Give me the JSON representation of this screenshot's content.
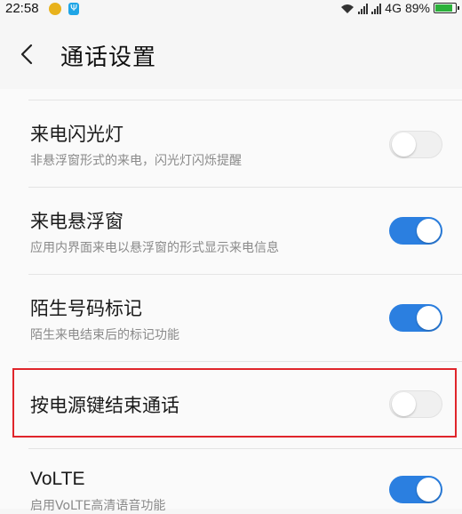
{
  "status_bar": {
    "time": "22:58",
    "usb_glyph": "Ψ",
    "network": "4G",
    "battery": "89%",
    "battery_level": 0.89,
    "icons": [
      "coin-icon",
      "usb-icon",
      "wifi-icon",
      "signal-icon",
      "signal-icon",
      "battery-icon"
    ]
  },
  "header": {
    "back_icon": "chevron-left-icon",
    "title": "通话设置"
  },
  "settings": [
    {
      "title": "来电闪光灯",
      "description": "非悬浮窗形式的来电，闪光灯闪烁提醒",
      "enabled": false
    },
    {
      "title": "来电悬浮窗",
      "description": "应用内界面来电以悬浮窗的形式显示来电信息",
      "enabled": true
    },
    {
      "title": "陌生号码标记",
      "description": "陌生来电结束后的标记功能",
      "enabled": true
    },
    {
      "title": "按电源键结束通话",
      "description": "",
      "enabled": false,
      "highlighted": true
    },
    {
      "title": "VoLTE",
      "description": "启用VoLTE高清语音功能",
      "enabled": true
    }
  ],
  "colors": {
    "toggle_on": "#2b7fe0",
    "toggle_off": "#f0f0f0",
    "highlight": "#e0252b",
    "battery": "#2ab13a"
  }
}
